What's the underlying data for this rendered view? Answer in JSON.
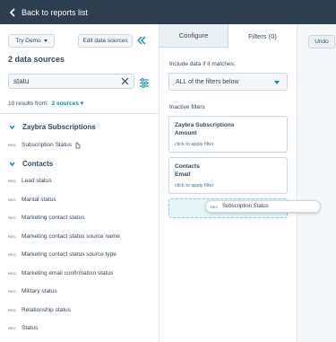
{
  "topbar": {
    "back_label": "Back to reports list"
  },
  "left": {
    "try_demo_label": "Try Demo",
    "edit_sources_label": "Edit data sources",
    "sources_title": "2 data sources",
    "search_value": "statu",
    "results_text": "10 results from:",
    "results_link": "2 sources",
    "groups": [
      {
        "name": "Zaybra Subscriptions",
        "props": [
          "Subscription Status"
        ]
      },
      {
        "name": "Contacts",
        "props": [
          "Lead status",
          "Marital status",
          "Marketing contact status",
          "Marketing contact status source name",
          "Marketing contact status source type",
          "Marketing email confirmation status",
          "Military status",
          "Relationship status",
          "Status"
        ]
      }
    ],
    "prop_tag": "REC"
  },
  "middle": {
    "tab_configure": "Configure",
    "tab_filters": "Filters (0)",
    "include_label": "Include data if it matches:",
    "match_value": "ALL of the filters below",
    "inactive_label": "Inactive filters",
    "cards": [
      {
        "title": "Zaybra Subscriptions",
        "property": "Amount",
        "hint": "click to apply filter"
      },
      {
        "title": "Contacts",
        "property": "Email",
        "hint": "click to apply filter"
      }
    ]
  },
  "drag": {
    "tag": "REC",
    "label": "Subscription Status"
  },
  "right": {
    "undo_label": "Undo"
  },
  "colors": {
    "topbar": "#2d3e50",
    "accent": "#0091ae",
    "text": "#33475b"
  }
}
